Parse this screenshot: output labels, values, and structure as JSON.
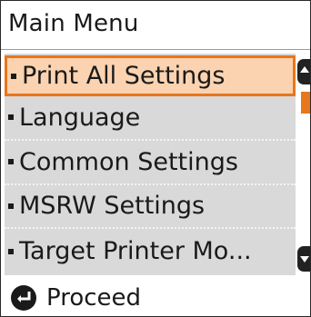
{
  "header": {
    "title": "Main Menu"
  },
  "menu": {
    "items": [
      {
        "label": "Print All Settings"
      },
      {
        "label": "Language"
      },
      {
        "label": "Common Settings"
      },
      {
        "label": "MSRW Settings"
      },
      {
        "label": "Target Printer Mo..."
      }
    ]
  },
  "footer": {
    "action_label": "Proceed",
    "icon": "enter-icon"
  },
  "colors": {
    "accent": "#e8761a",
    "selected_bg": "#fbd3b0",
    "list_bg": "#d9d9d9"
  }
}
